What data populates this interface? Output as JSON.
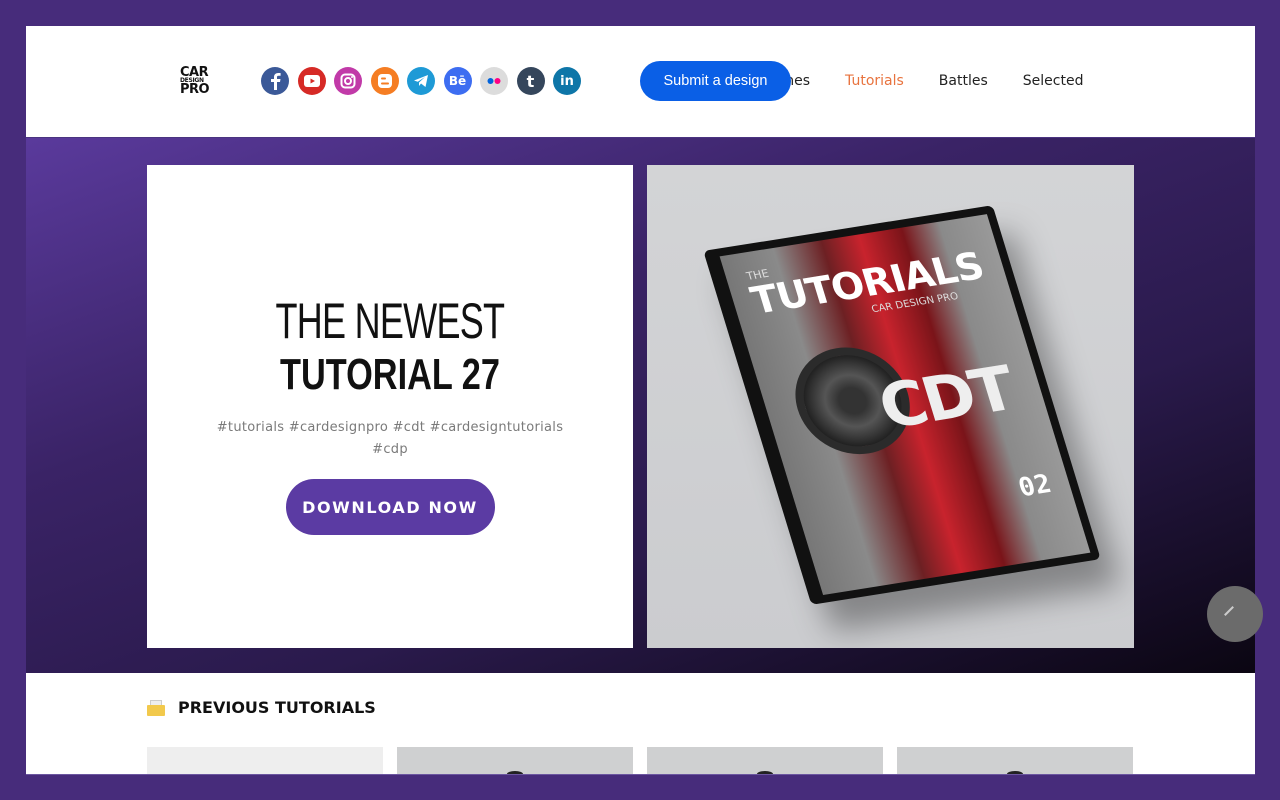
{
  "header": {
    "logo": {
      "line1": "CAR",
      "line2": "DESIGN",
      "line3": "PRO"
    },
    "socials": [
      {
        "name": "facebook",
        "color": "#3b5998"
      },
      {
        "name": "youtube",
        "color": "#d62a26"
      },
      {
        "name": "instagram",
        "color": "#c13aa8"
      },
      {
        "name": "blogger",
        "color": "#f57d23"
      },
      {
        "name": "telegram",
        "color": "#1e9ad6"
      },
      {
        "name": "behance",
        "color": "#3d6df1"
      },
      {
        "name": "flickr",
        "color": "#dcdcdc"
      },
      {
        "name": "tumblr",
        "color": "#35465c"
      },
      {
        "name": "linkedin",
        "color": "#0e76a8"
      }
    ],
    "submit_button": "Submit a design",
    "nav": [
      {
        "label": "zines",
        "active": false
      },
      {
        "label": "Tutorials",
        "active": true
      },
      {
        "label": "Battles",
        "active": false
      },
      {
        "label": "Selected",
        "active": false
      }
    ]
  },
  "hero": {
    "title_light": "THE NEWEST",
    "title_bold": "TUTORIAL 27",
    "tags": "#tutorials #cardesignpro #cdt #cardesigntutorials #cdp",
    "download_button": "DOWNLOAD NOW",
    "cover": {
      "the": "THE",
      "title": "TUTORIALS",
      "subtitle": "CAR DESIGN PRO",
      "brand": "CDT",
      "issue": "02"
    }
  },
  "previous": {
    "title": "PREVIOUS TUTORIALS",
    "cards": [
      {
        "id": 1
      },
      {
        "id": 2
      },
      {
        "id": 3
      },
      {
        "id": 4
      }
    ]
  },
  "colors": {
    "frame": "#472c7b",
    "accent_purple": "#5b3ba3",
    "submit_blue": "#0a5fe6",
    "nav_active": "#e8733e"
  }
}
